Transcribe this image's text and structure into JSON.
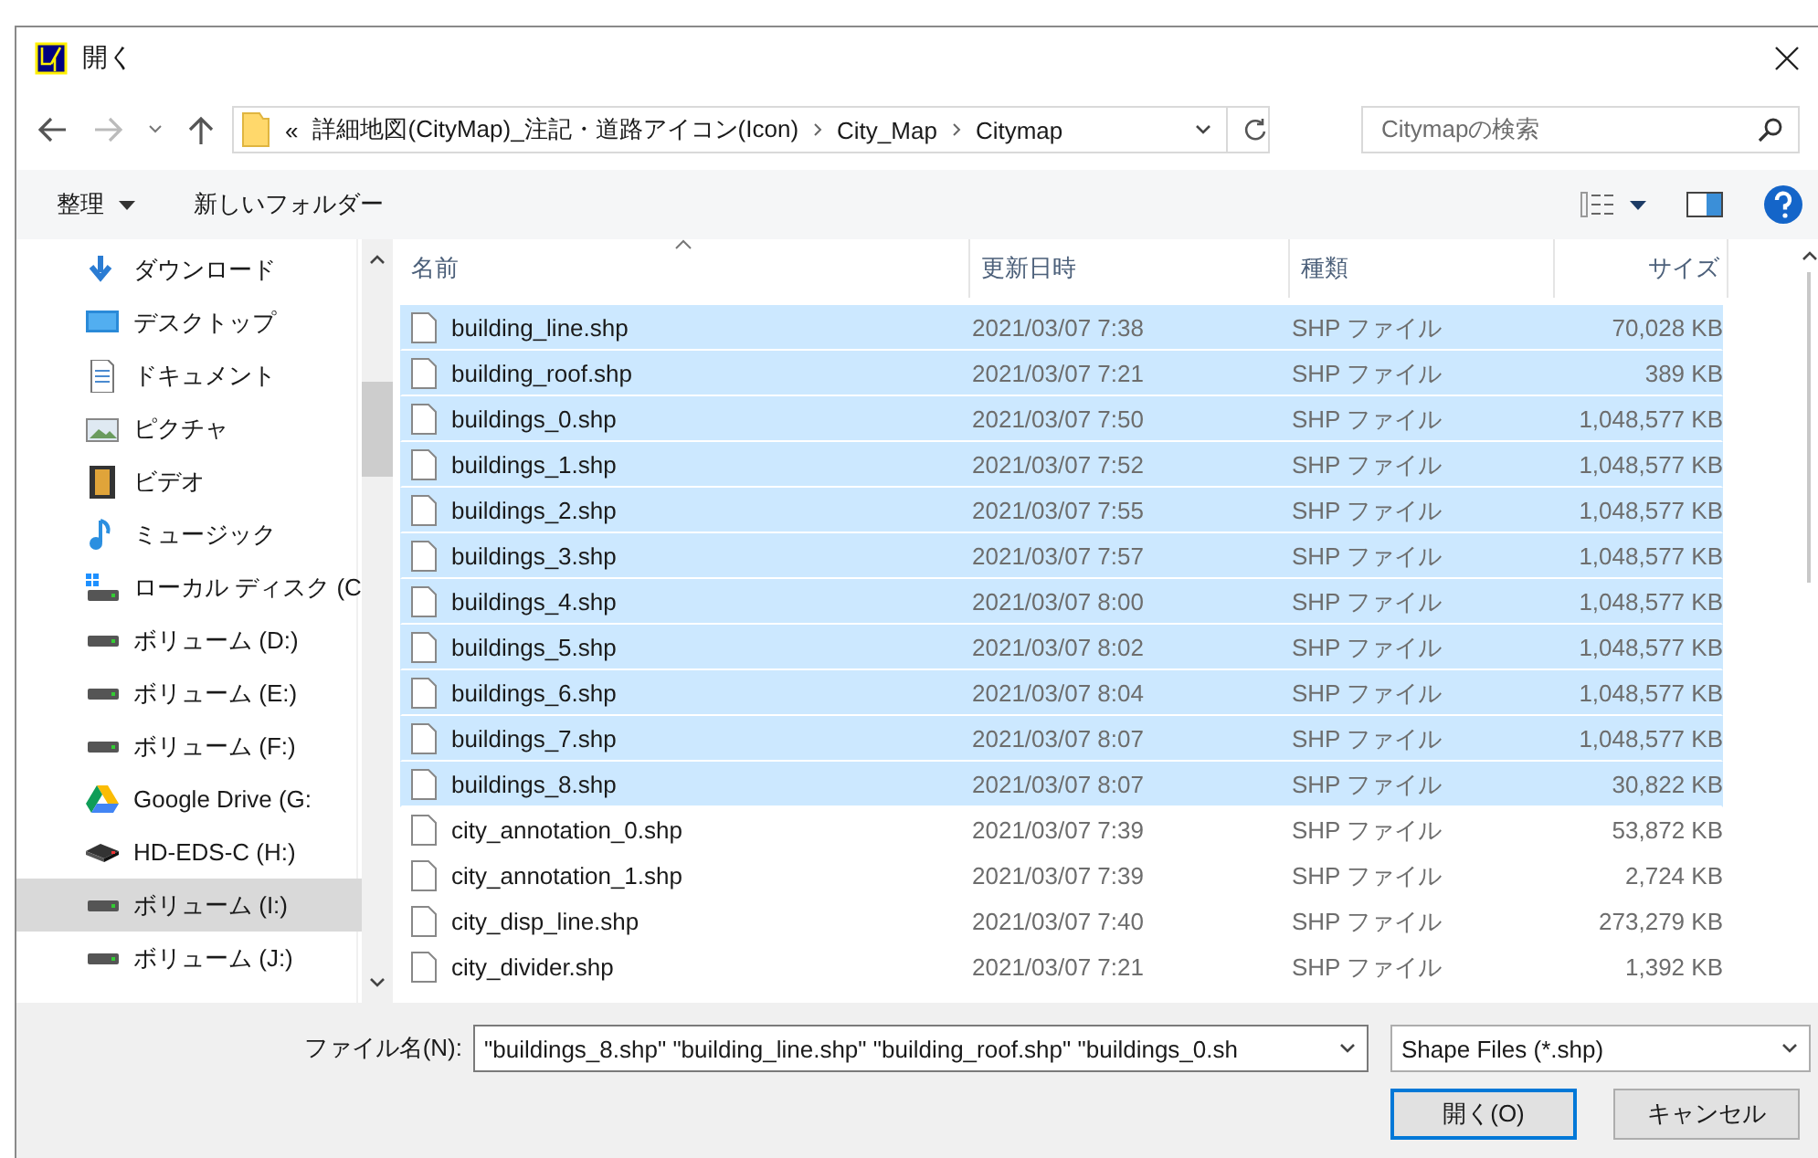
{
  "window": {
    "title": "開く"
  },
  "address_bar": {
    "overflow": "«",
    "breadcrumbs": [
      "詳細地図(CityMap)_注記・道路アイコン(Icon)",
      "City_Map",
      "Citymap"
    ]
  },
  "search": {
    "placeholder": "Citymapの検索"
  },
  "toolbar": {
    "organize": "整理",
    "new_folder": "新しいフォルダー"
  },
  "sidebar": {
    "items": [
      {
        "label": "ダウンロード",
        "kind": "download",
        "selected": false
      },
      {
        "label": "デスクトップ",
        "kind": "desktop",
        "selected": false
      },
      {
        "label": "ドキュメント",
        "kind": "document",
        "selected": false
      },
      {
        "label": "ピクチャ",
        "kind": "picture",
        "selected": false
      },
      {
        "label": "ビデオ",
        "kind": "video",
        "selected": false
      },
      {
        "label": "ミュージック",
        "kind": "music",
        "selected": false
      },
      {
        "label": "ローカル ディスク (C",
        "kind": "system",
        "selected": false
      },
      {
        "label": "ボリューム (D:)",
        "kind": "drive",
        "selected": false
      },
      {
        "label": "ボリューム (E:)",
        "kind": "drive",
        "selected": false
      },
      {
        "label": "ボリューム (F:)",
        "kind": "drive",
        "selected": false
      },
      {
        "label": "Google Drive (G:",
        "kind": "cloud",
        "selected": false
      },
      {
        "label": "HD-EDS-C (H:)",
        "kind": "external",
        "selected": false
      },
      {
        "label": "ボリューム (I:)",
        "kind": "drive",
        "selected": true
      },
      {
        "label": "ボリューム (J:)",
        "kind": "drive",
        "selected": false
      }
    ]
  },
  "table": {
    "columns": [
      {
        "label": "名前",
        "sorted": true
      },
      {
        "label": "更新日時",
        "sorted": false
      },
      {
        "label": "種類",
        "sorted": false
      },
      {
        "label": "サイズ",
        "sorted": false
      }
    ],
    "rows": [
      {
        "name": "building_line.shp",
        "date": "2021/03/07 7:38",
        "type": "SHP ファイル",
        "size": "70,028 KB",
        "selected": true
      },
      {
        "name": "building_roof.shp",
        "date": "2021/03/07 7:21",
        "type": "SHP ファイル",
        "size": "389 KB",
        "selected": true
      },
      {
        "name": "buildings_0.shp",
        "date": "2021/03/07 7:50",
        "type": "SHP ファイル",
        "size": "1,048,577 KB",
        "selected": true
      },
      {
        "name": "buildings_1.shp",
        "date": "2021/03/07 7:52",
        "type": "SHP ファイル",
        "size": "1,048,577 KB",
        "selected": true
      },
      {
        "name": "buildings_2.shp",
        "date": "2021/03/07 7:55",
        "type": "SHP ファイル",
        "size": "1,048,577 KB",
        "selected": true
      },
      {
        "name": "buildings_3.shp",
        "date": "2021/03/07 7:57",
        "type": "SHP ファイル",
        "size": "1,048,577 KB",
        "selected": true
      },
      {
        "name": "buildings_4.shp",
        "date": "2021/03/07 8:00",
        "type": "SHP ファイル",
        "size": "1,048,577 KB",
        "selected": true
      },
      {
        "name": "buildings_5.shp",
        "date": "2021/03/07 8:02",
        "type": "SHP ファイル",
        "size": "1,048,577 KB",
        "selected": true
      },
      {
        "name": "buildings_6.shp",
        "date": "2021/03/07 8:04",
        "type": "SHP ファイル",
        "size": "1,048,577 KB",
        "selected": true
      },
      {
        "name": "buildings_7.shp",
        "date": "2021/03/07 8:07",
        "type": "SHP ファイル",
        "size": "1,048,577 KB",
        "selected": true
      },
      {
        "name": "buildings_8.shp",
        "date": "2021/03/07 8:07",
        "type": "SHP ファイル",
        "size": "30,822 KB",
        "selected": true
      },
      {
        "name": "city_annotation_0.shp",
        "date": "2021/03/07 7:39",
        "type": "SHP ファイル",
        "size": "53,872 KB",
        "selected": false
      },
      {
        "name": "city_annotation_1.shp",
        "date": "2021/03/07 7:39",
        "type": "SHP ファイル",
        "size": "2,724 KB",
        "selected": false
      },
      {
        "name": "city_disp_line.shp",
        "date": "2021/03/07 7:40",
        "type": "SHP ファイル",
        "size": "273,279 KB",
        "selected": false
      },
      {
        "name": "city_divider.shp",
        "date": "2021/03/07 7:21",
        "type": "SHP ファイル",
        "size": "1,392 KB",
        "selected": false
      }
    ]
  },
  "footer": {
    "filename_label": "ファイル名(N):",
    "filename_value": "\"buildings_8.shp\" \"building_line.shp\" \"building_roof.shp\" \"buildings_0.sh",
    "filetype": "Shape Files (*.shp)",
    "buttons": [
      {
        "label": "開く(O)",
        "default": true
      },
      {
        "label": "キャンセル",
        "default": false
      }
    ]
  }
}
